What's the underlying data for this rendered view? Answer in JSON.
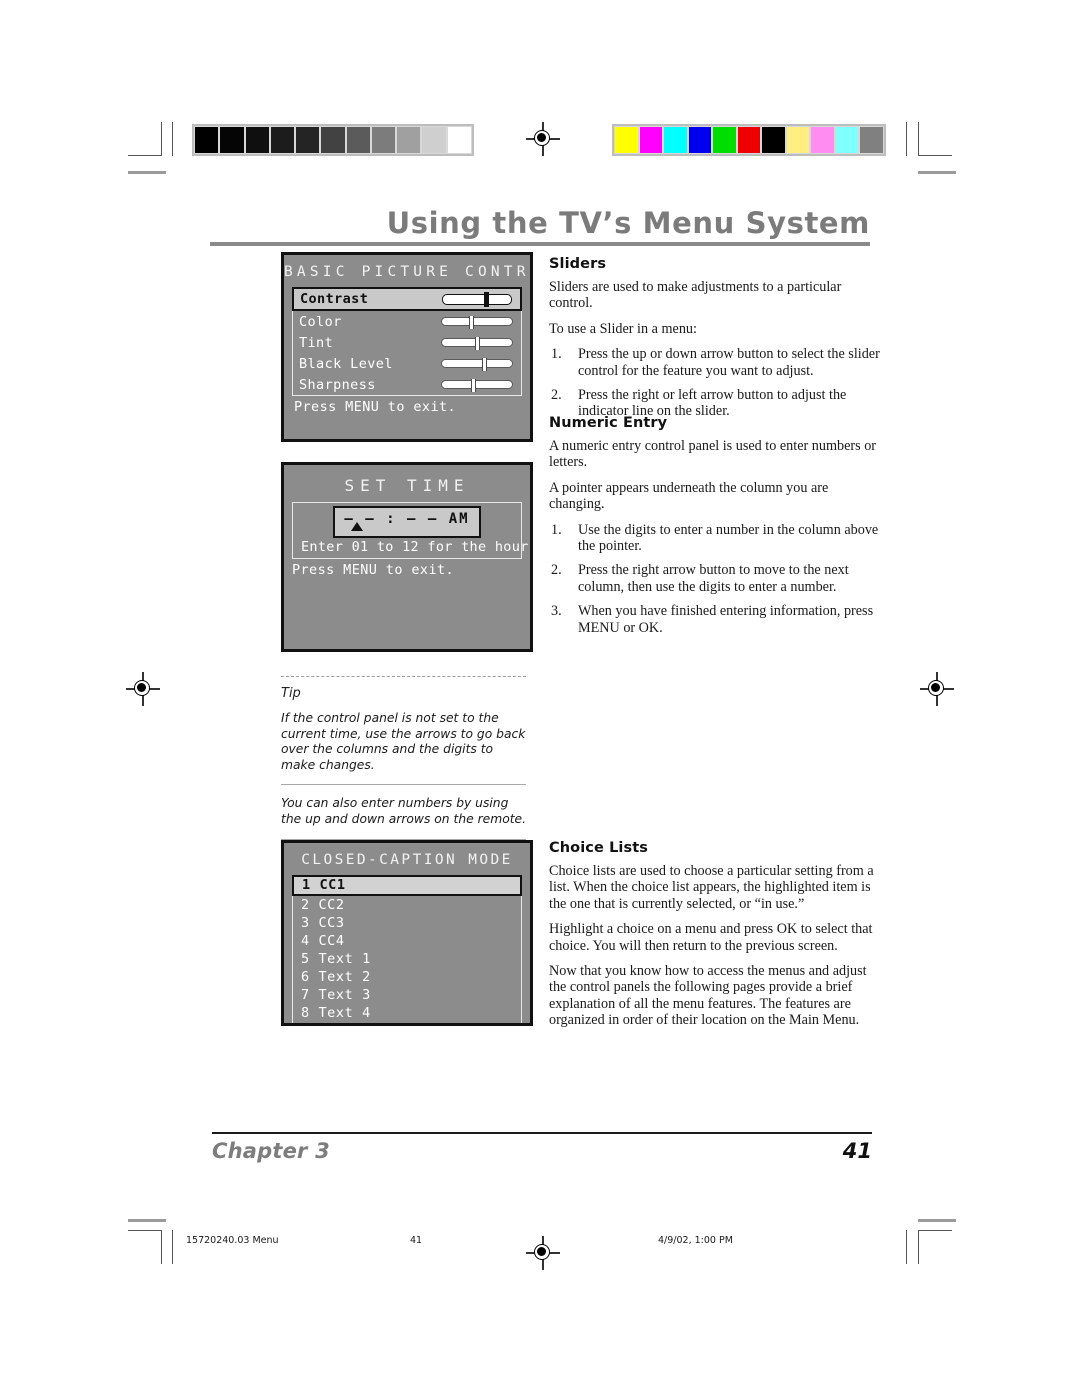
{
  "page": {
    "title": "Using the TV’s Menu System",
    "chapter_label": "Chapter 3",
    "page_number": "41"
  },
  "print_slug": {
    "file": "15720240.03 Menu",
    "folio": "41",
    "timestamp": "4/9/02, 1:00 PM"
  },
  "calibration": {
    "grayscale_swatches": [
      "#000000",
      "#050505",
      "#0f0f0f",
      "#1c1c1c",
      "#242424",
      "#424242",
      "#5b5b5b",
      "#7c7c7c",
      "#a0a0a0",
      "#cfcfcf",
      "#ffffff"
    ],
    "color_swatches": [
      "#ffff00",
      "#ff00ff",
      "#00ffff",
      "#0000ee",
      "#00dd00",
      "#ee0000",
      "#000000",
      "#ffef80",
      "#ff8cf0",
      "#80ffff",
      "#808080"
    ]
  },
  "panels": {
    "basic_picture": {
      "title": "BASIC PICTURE CONTROLS",
      "sliders": [
        {
          "label": "Contrast",
          "value": 60,
          "selected": true
        },
        {
          "label": "Color",
          "value": 38,
          "selected": false
        },
        {
          "label": "Tint",
          "value": 47,
          "selected": false
        },
        {
          "label": "Black Level",
          "value": 57,
          "selected": false
        },
        {
          "label": "Sharpness",
          "value": 42,
          "selected": false
        }
      ],
      "footer": "Press MENU to exit."
    },
    "set_time": {
      "title": "SET TIME",
      "digits": "— — : — —  AM",
      "hint": "Enter 01 to 12 for the hour.",
      "footer": "Press MENU to exit."
    },
    "closed_caption": {
      "title": "CLOSED-CAPTION MODE",
      "choices": [
        {
          "label": "1 CC1",
          "selected": true
        },
        {
          "label": "2 CC2",
          "selected": false
        },
        {
          "label": "3 CC3",
          "selected": false
        },
        {
          "label": "4 CC4",
          "selected": false
        },
        {
          "label": "5 Text 1",
          "selected": false
        },
        {
          "label": "6 Text 2",
          "selected": false
        },
        {
          "label": "7 Text 3",
          "selected": false
        },
        {
          "label": "8 Text 4",
          "selected": false
        }
      ]
    }
  },
  "sections": {
    "sliders": {
      "heading": "Sliders",
      "p1": "Sliders are used to make adjustments to a particular control.",
      "p2": "To use a Slider in a menu:",
      "steps": [
        {
          "num": "1.",
          "text": "Press the up or down arrow button to select the slider control for the feature you want to adjust."
        },
        {
          "num": "2.",
          "text": "Press the right or left arrow button to adjust the indicator line on the slider."
        }
      ]
    },
    "numeric_entry": {
      "heading": "Numeric Entry",
      "p1": "A numeric entry control panel is used to enter numbers or letters.",
      "p2": "A pointer appears underneath the column you are changing.",
      "steps": [
        {
          "num": "1.",
          "text": "Use the digits to enter a number in the column above the pointer."
        },
        {
          "num": "2.",
          "text": "Press the right arrow button to move to the next column, then use the digits to enter a number."
        },
        {
          "num": "3.",
          "text": "When you have finished entering information, press MENU or OK."
        }
      ]
    },
    "choice_lists": {
      "heading": "Choice Lists",
      "p1": "Choice lists are used to choose a particular setting from a list. When the choice list appears, the highlighted item is the one that is currently selected, or “in use.”",
      "p2": "Highlight a choice on a menu and press OK to select that choice. You will then return to the previous screen.",
      "p3": "Now that you know how to access the menus and adjust the control panels the following pages provide a brief explanation of all the menu features. The features are organized in order of their location on the Main Menu."
    }
  },
  "tip": {
    "label": "Tip",
    "text1": "If the control panel is not set to the current time, use the arrows to go back over the columns and the digits to make changes.",
    "text2": "You can also enter numbers by using the up and down arrows on the remote."
  }
}
